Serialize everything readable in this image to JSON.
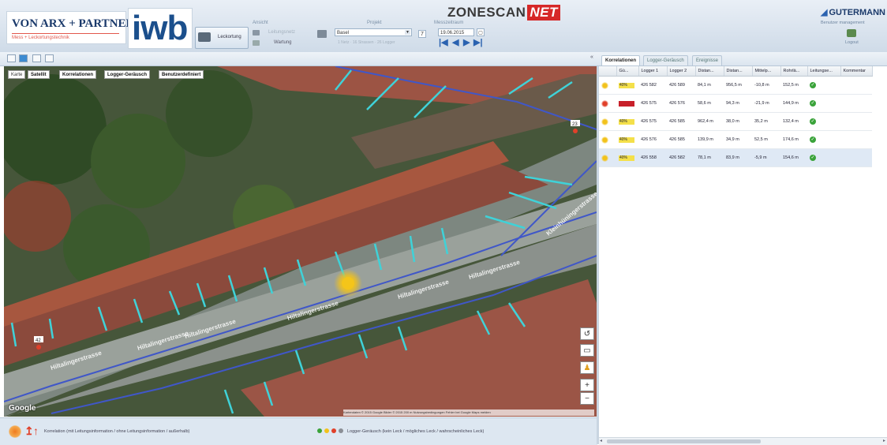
{
  "header": {
    "company": "VON ARX + PARTNER AG",
    "company_sub": "Mess + Leckortungstechnik",
    "logo": "iwb",
    "ansicht_title": "Ansicht",
    "leckortung_label": "Leckortung",
    "leitungsnetz_label": "Leitungsnetz",
    "wartung_label": "Wartung",
    "projekt_title": "Projekt",
    "projekt_value": "Basel",
    "projekt_sub": "1 Netz · 16 Strassen · 26 Logger",
    "messzeitraum_title": "Messzeitraum",
    "messzeitraum_value": "19.06.2015",
    "brand_main": "ZONESCAN",
    "brand_accent": "NET",
    "vendor": "GUTERMANN",
    "user": "Benutzer management",
    "logout": "Logout"
  },
  "tabs": [
    "Korrelationen",
    "Logger-Geräusch",
    "Ereignisse"
  ],
  "map": {
    "karte": "Karte",
    "satellit": "Satellit",
    "btn_korrelationen": "Korrelationen",
    "btn_logger_geraeusch": "Logger-Geräusch",
    "btn_benutzerdefiniert": "Benutzerdefiniert",
    "google": "Google",
    "attribution": "Kartendaten © 2015 Google  Bilder © 2015  200 m  Nutzungsbedingungen  Fehler bei Google Maps melden",
    "street_labels": [
      "Hiltalingerstrasse",
      "Hiltalingerstrasse",
      "Hiltalingerstrasse",
      "Hiltalingerstrasse",
      "Hiltalingerstrasse",
      "Kleinhüningerstrasse",
      "Hiltalingerstrasse"
    ],
    "markers": [
      "23",
      "42"
    ]
  },
  "legend": {
    "korrelation_text": "Korrelation (mit Leitungsinformation / ohne Leitungsinformation / außerhalb)",
    "logger_text": "Logger-Geräusch (kein Leck / mögliches Leck / wahrscheinliches Leck)"
  },
  "table": {
    "columns": [
      "",
      "Gü...",
      "Logger 1",
      "Logger 2",
      "Distan...",
      "Distan...",
      "Mittelp...",
      "Rohrlä...",
      "Leitungse...",
      "Kommentar"
    ],
    "rows": [
      {
        "dot": "#f2c21b",
        "quality": "40%",
        "qcolor": "#f4e04a",
        "logger1": "426 582",
        "logger2": "426 589",
        "d1": "84,1 m",
        "d2": "956,5 m",
        "mid": "-10,8 m",
        "pipe": "152,5 m",
        "selected": false
      },
      {
        "dot": "#e0402a",
        "quality": "",
        "qcolor": "#c8202a",
        "logger1": "426 575",
        "logger2": "426 576",
        "d1": "58,6 m",
        "d2": "94,3 m",
        "mid": "-21,9 m",
        "pipe": "144,9 m",
        "selected": false
      },
      {
        "dot": "#f2c21b",
        "quality": "40%",
        "qcolor": "#f4e04a",
        "logger1": "426 575",
        "logger2": "426 585",
        "d1": "962,4 m",
        "d2": "38,0 m",
        "mid": "35,2 m",
        "pipe": "132,4 m",
        "selected": false
      },
      {
        "dot": "#f2c21b",
        "quality": "40%",
        "qcolor": "#f4e04a",
        "logger1": "426 576",
        "logger2": "426 585",
        "d1": "139,9 m",
        "d2": "34,9 m",
        "mid": "52,5 m",
        "pipe": "174,6 m",
        "selected": false
      },
      {
        "dot": "#f2c21b",
        "quality": "40%",
        "qcolor": "#f4e04a",
        "logger1": "426 558",
        "logger2": "426 582",
        "d1": "78,1 m",
        "d2": "83,9 m",
        "mid": "-5,9 m",
        "pipe": "154,6 m",
        "selected": true
      }
    ]
  },
  "colors": {
    "accent_blue": "#2a62b0",
    "correlation_line": "#3fd2d8",
    "pipe_line": "#4057c8",
    "leak_yellow": "#f2c21b",
    "leak_red": "#e0402a",
    "ok_green": "#3aa33a"
  }
}
